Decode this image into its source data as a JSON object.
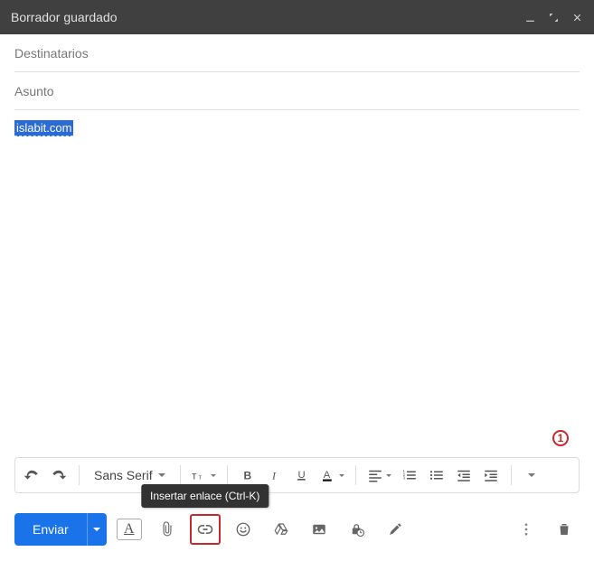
{
  "header": {
    "title": "Borrador guardado"
  },
  "fields": {
    "recipients_placeholder": "Destinatarios",
    "subject_placeholder": "Asunto"
  },
  "body": {
    "selected_link_text": "islabit.com"
  },
  "annotation": {
    "label": "1"
  },
  "format_toolbar": {
    "font": "Sans Serif"
  },
  "tooltip": {
    "insert_link": "Insertar enlace (Ctrl-K)"
  },
  "actions": {
    "send_label": "Enviar"
  }
}
